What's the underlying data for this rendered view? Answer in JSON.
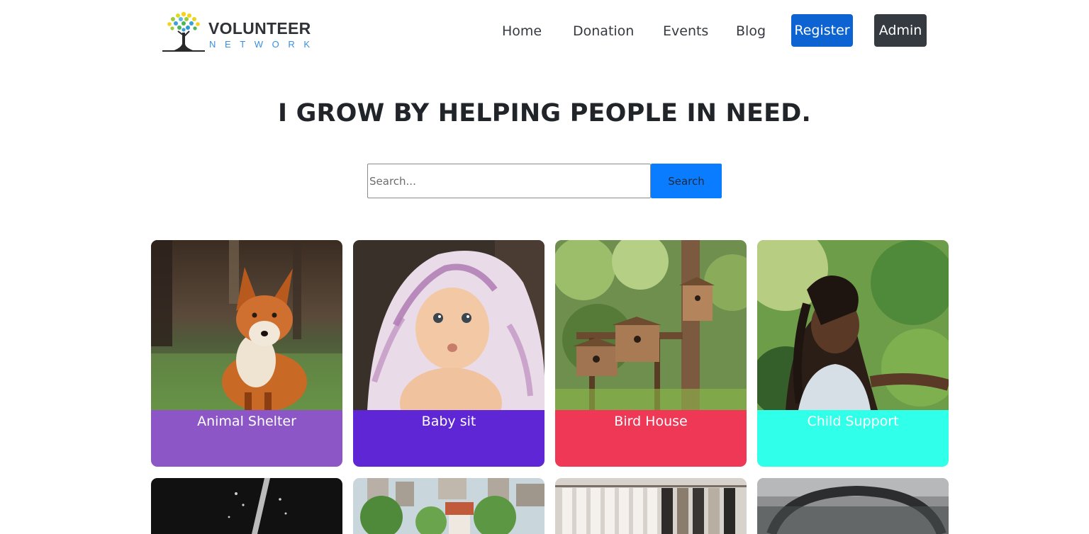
{
  "brand": {
    "name": "VOLUNTEER",
    "sub": "NETWORK"
  },
  "nav": {
    "home": "Home",
    "donation": "Donation",
    "events": "Events",
    "blog": "Blog",
    "register": "Register",
    "admin": "Admin"
  },
  "colors": {
    "register_bg": "#0d63d1",
    "admin_bg": "#343a40",
    "search_btn_bg": "#0a7cff"
  },
  "hero": {
    "title": "I GROW BY HELPING PEOPLE IN NEED."
  },
  "search": {
    "placeholder": "Search...",
    "value": "",
    "button": "Search"
  },
  "cards": [
    {
      "label": "Animal Shelter",
      "color": "#8c56c7",
      "image": "fox-photo"
    },
    {
      "label": "Baby sit",
      "color": "#5f26d6",
      "image": "baby-photo"
    },
    {
      "label": "Bird House",
      "color": "#ef3856",
      "image": "birdhouse-photo"
    },
    {
      "label": "Child Support",
      "color": "#30ffea",
      "image": "child-photo"
    }
  ],
  "more_cards": [
    {
      "image": "water-photo"
    },
    {
      "image": "city-park-photo"
    },
    {
      "image": "clothes-rack-photo"
    },
    {
      "image": "car-interior-photo"
    }
  ]
}
